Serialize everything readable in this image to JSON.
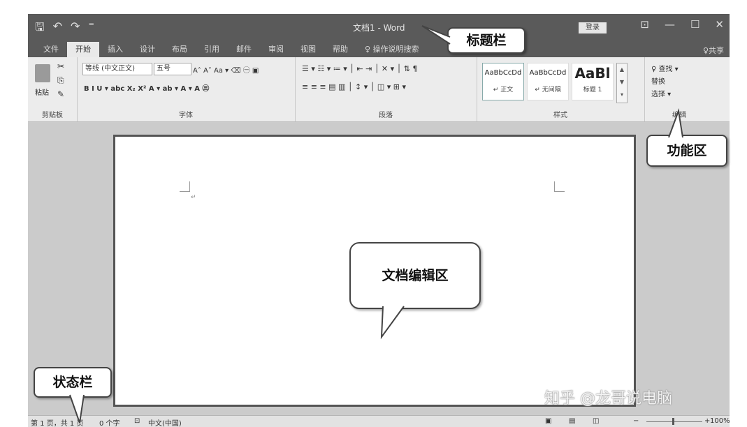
{
  "window": {
    "title": "文档1 - Word",
    "login_label": "登录",
    "quick_access": [
      "🖫",
      "↶",
      "↷",
      "⁼"
    ],
    "window_controls": [
      "⊡",
      "—",
      "☐",
      "✕"
    ]
  },
  "menu": {
    "tabs": [
      "文件",
      "开始",
      "插入",
      "设计",
      "布局",
      "引用",
      "邮件",
      "审阅",
      "视图",
      "帮助"
    ],
    "active_tab": 1,
    "tell_me": "♀ 操作说明搜索",
    "share": "♀共享"
  },
  "ribbon": {
    "clipboard": {
      "label": "剪贴板",
      "paste": "粘贴"
    },
    "font": {
      "label": "字体",
      "font_name": "等线 (中文正文)",
      "font_size": "五号",
      "row2": "B  I  U  ▾  abc  X₂  X²   A ▾  ab ▾  A ▾  A  ㊂"
    },
    "paragraph": {
      "label": "段落"
    },
    "styles": {
      "label": "样式",
      "tiles": [
        {
          "sample": "AaBbCcDd",
          "name": "↵ 正文"
        },
        {
          "sample": "AaBbCcDd",
          "name": "↵ 无间隔"
        },
        {
          "sample": "AaBl",
          "name": "标题 1"
        }
      ]
    },
    "editing": {
      "label": "编辑",
      "find": "♀ 查找 ▾",
      "replace": "替换",
      "select": "选择 ▾"
    }
  },
  "status": {
    "page": "第 1 页，共 1 页",
    "words": "0 个字",
    "lang": "中文(中国)",
    "zoom": "100%"
  },
  "callouts": {
    "title_bar": "标题栏",
    "ribbon": "功能区",
    "edit_area": "文档编辑区",
    "status_bar": "状态栏"
  },
  "watermark": "知乎 @龙哥说电脑",
  "colors": {
    "title_bar": "#5a5a5a",
    "ribbon": "#ececec",
    "doc_bg": "#cbcbcb"
  }
}
